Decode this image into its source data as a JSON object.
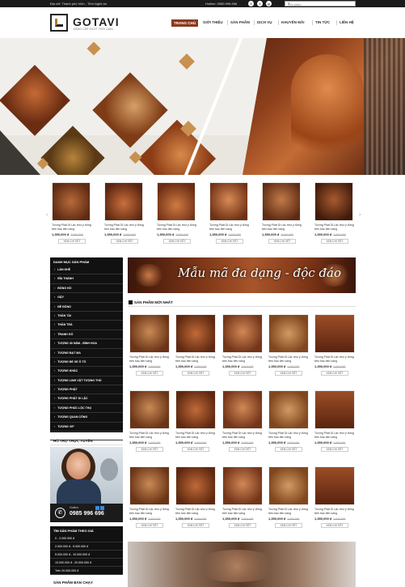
{
  "topbar": {
    "address": "Địa chỉ: Thành phố Vinh - Tỉnh Nghệ An",
    "hotline": "Hotline: 0985.996.696",
    "social": [
      "f",
      "t",
      "g"
    ],
    "search_placeholder": "Tìm kiếm"
  },
  "header": {
    "logo_text": "GOTAVI",
    "logo_sub": "ĐẲNG CẤP VƯỢT THỜI GIAN",
    "nav": [
      "TRANG CHỦ",
      "GIỚI THIỆU",
      "SẢN PHẨM",
      "DỊCH VỤ",
      "KHUYẾN MÃI",
      "TIN TỨC",
      "LIÊN HỆ"
    ]
  },
  "carousel": {
    "arrow_left": "‹",
    "arrow_right": "›",
    "products": [
      {
        "name": "Tượng Phật Di Lặc như ý đứng trên bao tiền vàng",
        "price": "1,350,000 đ",
        "old_price": "2,000,000",
        "button": "XEM CHI TIẾT"
      },
      {
        "name": "Tượng Phật Di Lặc như ý đứng trên bao tiền vàng",
        "price": "1,350,000 đ",
        "old_price": "2,000,000",
        "button": "XEM CHI TIẾT"
      },
      {
        "name": "Tượng Phật Di Lặc như ý đứng trên bao tiền vàng",
        "price": "1,350,000 đ",
        "old_price": "2,000,000",
        "button": "XEM CHI TIẾT"
      },
      {
        "name": "Tượng Phật Di Lặc như ý đứng trên bao tiền vàng",
        "price": "1,350,000 đ",
        "old_price": "2,000,000",
        "button": "XEM CHI TIẾT"
      },
      {
        "name": "Tượng Phật Di Lặc như ý đứng trên bao tiền vàng",
        "price": "1,350,000 đ",
        "old_price": "2,000,000",
        "button": "XEM CHI TIẾT"
      },
      {
        "name": "Tượng Phật Di Lặc như ý đứng trên bao tiền vàng",
        "price": "1,350,000 đ",
        "old_price": "2,000,000",
        "button": "XEM CHI TIẾT"
      }
    ]
  },
  "sidebar": {
    "categories_title": "DANH MỤC SẢN PHẨM",
    "categories": [
      "LÀN KHỀ",
      "ĐĨA THÁNH",
      "ĐỒNG HỒ",
      "GẬY",
      "ĐỀ ĐỒNG",
      "THẦN TÀI",
      "THẦN TRÀ",
      "TRANH GỖ",
      "TƯỢNG 30 NĂM - BÌNH HOA",
      "TƯỢNG ĐẠT MA",
      "TƯỢNG ĐỂ XE Ô TÔ",
      "TƯỢNG KHÁC",
      "TƯỢNG LINH VẬT TƯỢNG THÚ",
      "TƯỢNG PHẬT",
      "TƯỢNG PHẬT DI LẶC",
      "TƯỢNG PHÚC LỘC THỌ",
      "TƯỢNG QUAN CÔNG",
      "TƯỢNG VIP",
      "XEM PHẨM KHÁC"
    ],
    "support_title": "HỖ TRỢ TRỰC TUYẾN",
    "hotline_label": "Hotline",
    "hotline_number": "0985 996 696",
    "price_title": "TÌM SẢN PHẨM THEO GIÁ",
    "price_ranges": [
      "0 - 2.000.000 đ",
      "2.000.000 đ - 5.000.000 đ",
      "5.000.000 đ - 10.000.000 đ",
      "10.000.000 đ - 20.000.000 đ",
      "Trên 20.000.000 đ"
    ],
    "best_title": "SẢN PHẨM BÁN CHẠY"
  },
  "main": {
    "promo_text": "Mẫu mã đa dạng - độc đáo",
    "new_title": "SẢN PHẨM MỚI NHẤT",
    "grid": [
      {
        "name": "Tượng Phật Di Lặc như ý đứng trên bao tiền vàng",
        "price": "1,350,000 đ",
        "old_price": "2,000,000",
        "button": "XEM CHI TIẾT"
      },
      {
        "name": "Tượng Phật Di Lặc như ý đứng trên bao tiền vàng",
        "price": "1,350,000 đ",
        "old_price": "2,000,000",
        "button": "XEM CHI TIẾT"
      },
      {
        "name": "Tượng Phật Di Lặc như ý đứng trên bao tiền vàng",
        "price": "1,350,000 đ",
        "old_price": "2,000,000",
        "button": "XEM CHI TIẾT"
      },
      {
        "name": "Tượng Phật Di Lặc như ý đứng trên bao tiền vàng",
        "price": "1,350,000 đ",
        "old_price": "2,000,000",
        "button": "XEM CHI TIẾT"
      },
      {
        "name": "Tượng Phật Di Lặc như ý đứng trên bao tiền vàng",
        "price": "1,350,000 đ",
        "old_price": "2,000,000",
        "button": "XEM CHI TIẾT"
      },
      {
        "name": "Tượng Phật Di Lặc như ý đứng trên bao tiền vàng",
        "price": "1,350,000 đ",
        "old_price": "2,000,000",
        "button": "XEM CHI TIẾT"
      },
      {
        "name": "Tượng Phật Di Lặc như ý đứng trên bao tiền vàng",
        "price": "1,350,000 đ",
        "old_price": "2,000,000",
        "button": "XEM CHI TIẾT"
      },
      {
        "name": "Tượng Phật Di Lặc như ý đứng trên bao tiền vàng",
        "price": "1,350,000 đ",
        "old_price": "2,000,000",
        "button": "XEM CHI TIẾT"
      },
      {
        "name": "Tượng Phật Di Lặc như ý đứng trên bao tiền vàng",
        "price": "1,350,000 đ",
        "old_price": "2,000,000",
        "button": "XEM CHI TIẾT"
      },
      {
        "name": "Tượng Phật Di Lặc như ý đứng trên bao tiền vàng",
        "price": "1,350,000 đ",
        "old_price": "2,000,000",
        "button": "XEM CHI TIẾT"
      },
      {
        "name": "Tượng Phật Di Lặc như ý đứng trên bao tiền vàng",
        "price": "1,350,000 đ",
        "old_price": "2,000,000",
        "button": "XEM CHI TIẾT"
      },
      {
        "name": "Tượng Phật Di Lặc như ý đứng trên bao tiền vàng",
        "price": "1,350,000 đ",
        "old_price": "2,000,000",
        "button": "XEM CHI TIẾT"
      },
      {
        "name": "Tượng Phật Di Lặc như ý đứng trên bao tiền vàng",
        "price": "1,350,000 đ",
        "old_price": "2,000,000",
        "button": "XEM CHI TIẾT"
      },
      {
        "name": "Tượng Phật Di Lặc như ý đứng trên bao tiền vàng",
        "price": "1,350,000 đ",
        "old_price": "2,000,000",
        "button": "XEM CHI TIẾT"
      },
      {
        "name": "Tượng Phật Di Lặc như ý đứng trên bao tiền vàng",
        "price": "1,350,000 đ",
        "old_price": "2,000,000",
        "button": "XEM CHI TIẾT"
      }
    ]
  },
  "colors": {
    "accent": "#8b3a1b",
    "dark": "#111111"
  }
}
